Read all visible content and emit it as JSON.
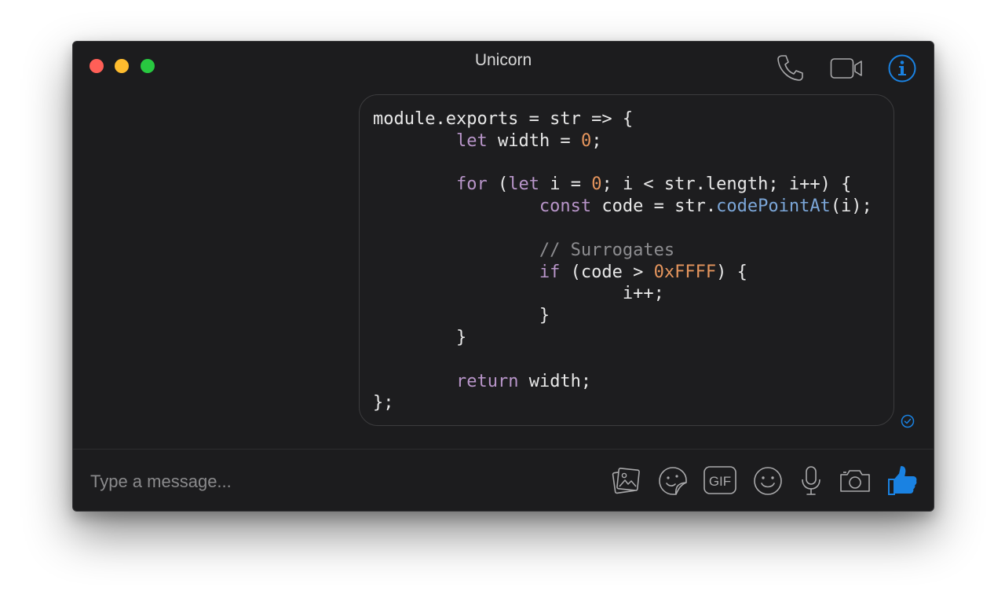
{
  "window": {
    "title": "Unicorn",
    "traffic_lights": {
      "close": "#ff5f57",
      "minimize": "#febc2e",
      "zoom": "#28c840"
    }
  },
  "toolbar": {
    "icons": [
      "phone-icon",
      "video-camera-icon",
      "info-icon"
    ]
  },
  "message": {
    "code_lines": [
      [
        {
          "t": "module.exports = str => {"
        }
      ],
      [
        {
          "t": "        "
        },
        {
          "t": "let",
          "c": "kw"
        },
        {
          "t": " width = "
        },
        {
          "t": "0",
          "c": "num"
        },
        {
          "t": ";"
        }
      ],
      [
        {
          "t": ""
        }
      ],
      [
        {
          "t": "        "
        },
        {
          "t": "for",
          "c": "kw"
        },
        {
          "t": " ("
        },
        {
          "t": "let",
          "c": "kw"
        },
        {
          "t": " i = "
        },
        {
          "t": "0",
          "c": "num"
        },
        {
          "t": "; i < str.length; i++) {"
        }
      ],
      [
        {
          "t": "                "
        },
        {
          "t": "const",
          "c": "kw"
        },
        {
          "t": " code = str."
        },
        {
          "t": "codePointAt",
          "c": "fn"
        },
        {
          "t": "(i);"
        }
      ],
      [
        {
          "t": ""
        }
      ],
      [
        {
          "t": "                "
        },
        {
          "t": "// Surrogates",
          "c": "cmt"
        }
      ],
      [
        {
          "t": "                "
        },
        {
          "t": "if",
          "c": "kw"
        },
        {
          "t": " (code > "
        },
        {
          "t": "0xFFFF",
          "c": "num"
        },
        {
          "t": ") {"
        }
      ],
      [
        {
          "t": "                        i++;"
        }
      ],
      [
        {
          "t": "                }"
        }
      ],
      [
        {
          "t": "        }"
        }
      ],
      [
        {
          "t": ""
        }
      ],
      [
        {
          "t": "        "
        },
        {
          "t": "return",
          "c": "kw"
        },
        {
          "t": " width;"
        }
      ],
      [
        {
          "t": "};"
        }
      ]
    ],
    "status_icon": "read-receipt-icon"
  },
  "composer": {
    "placeholder": "Type a message...",
    "value": "",
    "icons": [
      "photo-icon",
      "sticker-icon",
      "gif-icon",
      "emoji-icon",
      "microphone-icon",
      "camera-icon",
      "thumbs-up-icon"
    ],
    "gif_label": "GIF"
  },
  "colors": {
    "accent": "#1a82e2",
    "window_bg": "#1c1c1e",
    "keyword": "#b895c9",
    "number": "#e5955d",
    "function": "#7ba6d8",
    "comment": "#8d8d90"
  }
}
